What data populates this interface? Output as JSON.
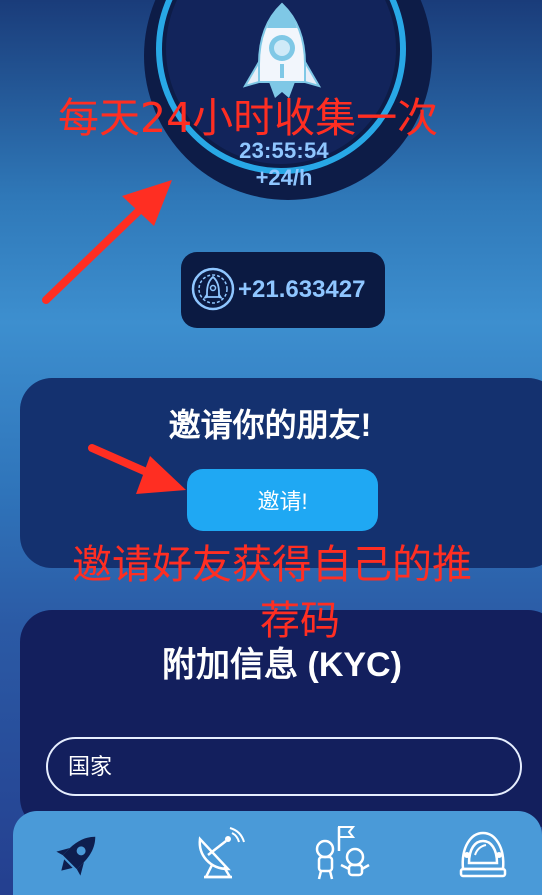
{
  "dial": {
    "timer": "23:55:54",
    "rate": "+24/h",
    "icon": "rocket-icon"
  },
  "balance": {
    "value": "+21.633427",
    "icon": "rocket-coin-icon"
  },
  "invite": {
    "title": "邀请你的朋友!",
    "button_label": "邀请!"
  },
  "kyc": {
    "title": "附加信息 (KYC)",
    "country_placeholder": "国家"
  },
  "bottom_nav": {
    "items": [
      {
        "icon": "rocket-icon",
        "active": true
      },
      {
        "icon": "satellite-dish-icon",
        "active": false
      },
      {
        "icon": "astronauts-flag-icon",
        "active": false
      },
      {
        "icon": "astronaut-helmet-icon",
        "active": false
      }
    ]
  },
  "annotations": {
    "collect_note": "每天24小时收集一次",
    "invite_note_line1": "邀请好友获得自己的推",
    "invite_note_line2": "荐码"
  },
  "colors": {
    "background_top": "#1a3c7a",
    "accent_blue": "#1fa8f3",
    "dial_ring": "#28a8e6",
    "readout_text": "#8fc6ff",
    "annotation_red": "#ff2e22"
  }
}
